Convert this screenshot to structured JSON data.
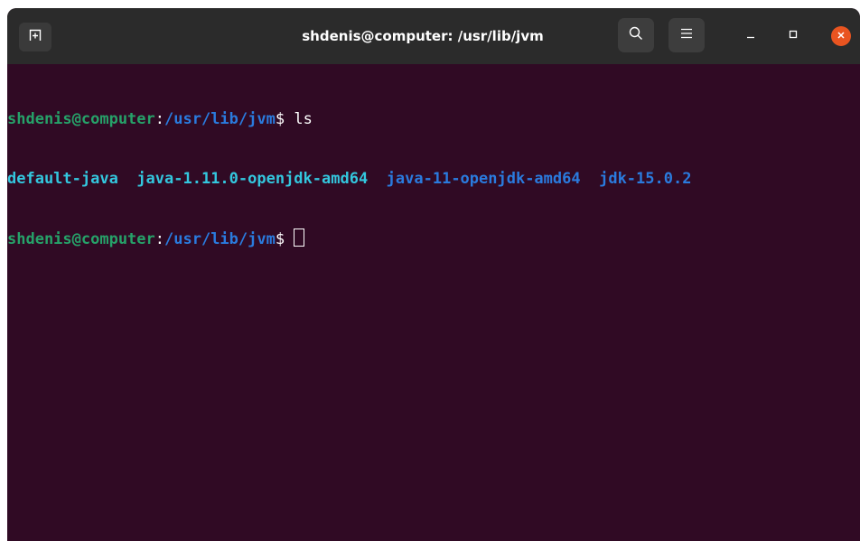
{
  "window": {
    "title": "shdenis@computer: /usr/lib/jvm",
    "close_color": "#e95420"
  },
  "icons": {
    "new_tab": "new-tab-icon",
    "search": "search-icon",
    "menu": "hamburger-menu-icon",
    "minimize": "minimize-icon",
    "maximize": "maximize-icon",
    "close": "close-icon"
  },
  "terminal": {
    "background": "#300a24",
    "lines": [
      {
        "user_host": "shdenis@computer",
        "colon": ":",
        "path": "/usr/lib/jvm",
        "prompt": "$ ",
        "command": "ls"
      },
      {
        "entries": [
          "default-java",
          "java-1.11.0-openjdk-amd64",
          "java-11-openjdk-amd64",
          "jdk-15.0.2"
        ]
      },
      {
        "user_host": "shdenis@computer",
        "colon": ":",
        "path": "/usr/lib/jvm",
        "prompt": "$ ",
        "command": ""
      }
    ]
  }
}
